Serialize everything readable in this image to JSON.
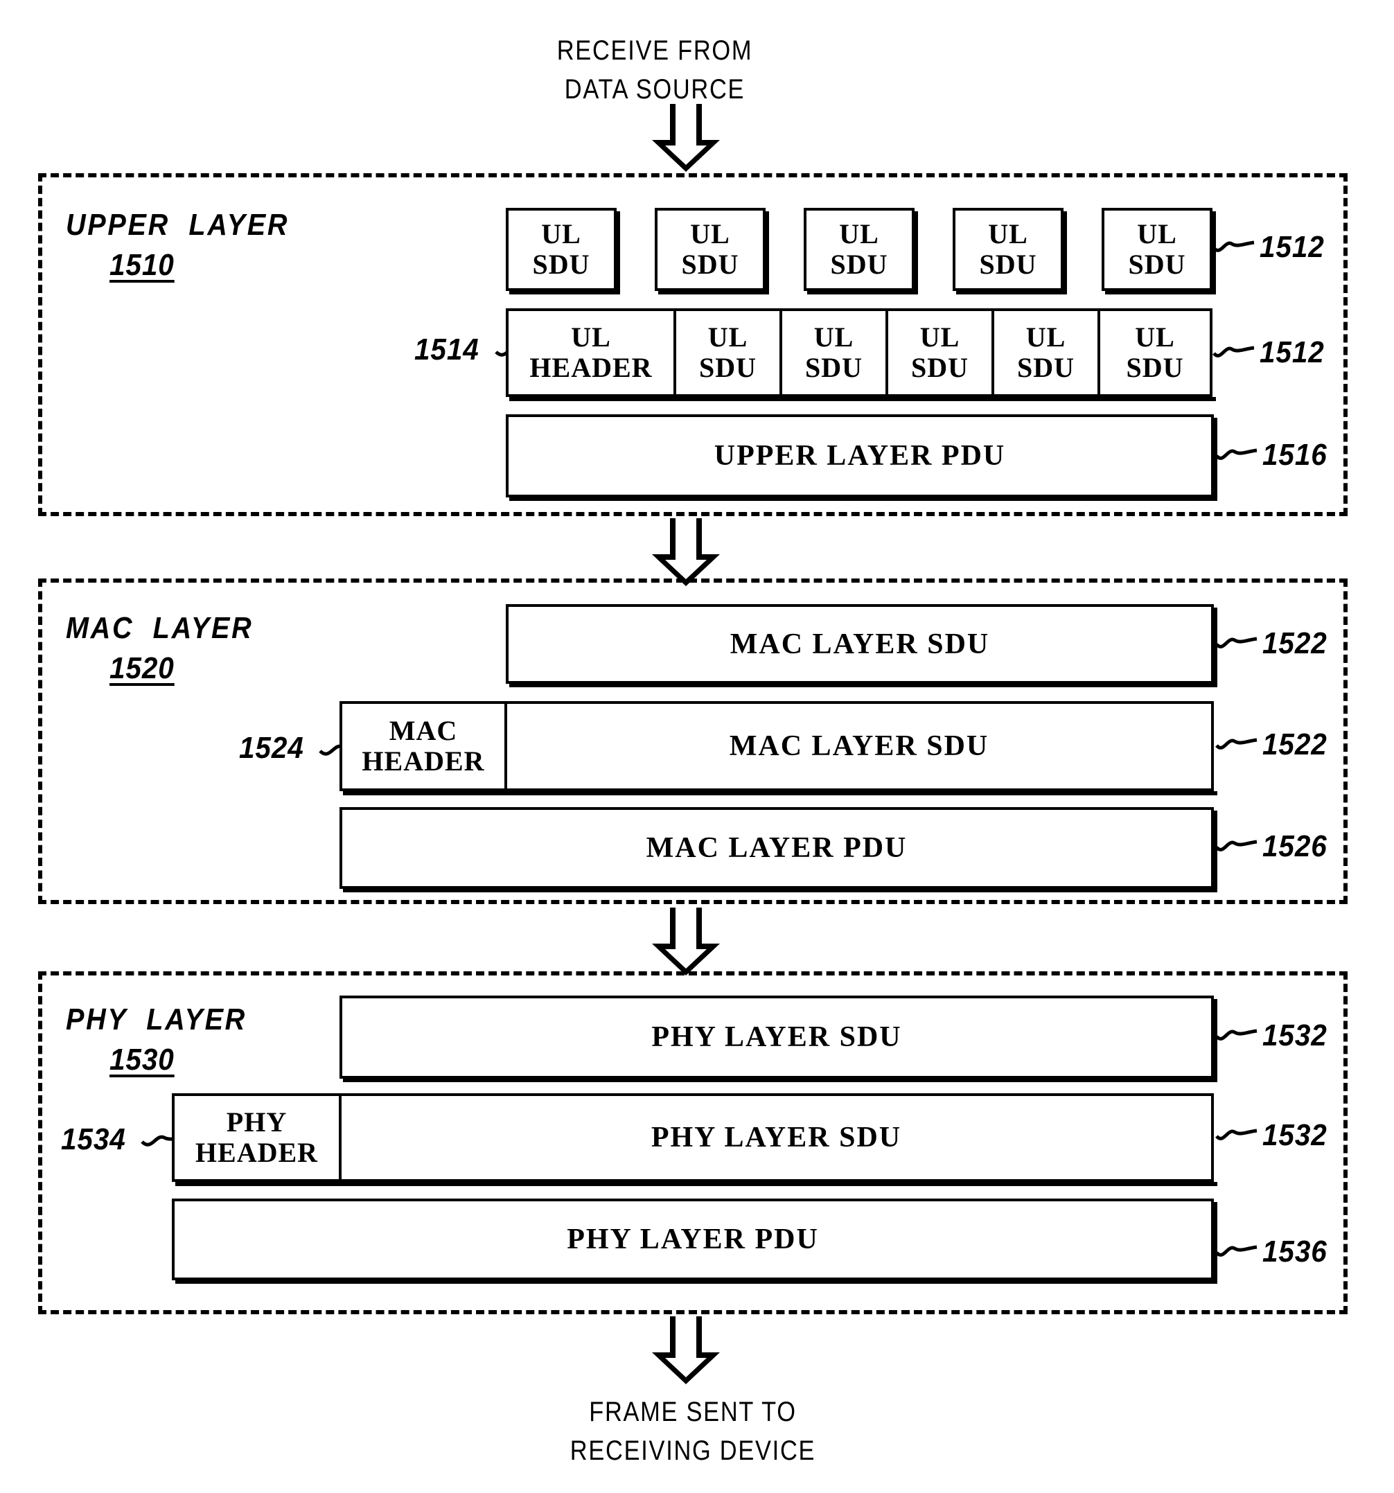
{
  "figure": {
    "top_caption": "RECEIVE FROM\nDATA SOURCE",
    "bottom_caption": "FRAME SENT TO\nRECEIVING DEVICE"
  },
  "layers": [
    {
      "id": "upper",
      "title": "UPPER  LAYER",
      "number": "1510",
      "rows": [
        {
          "kind": "sdu-row",
          "cells": [
            {
              "label": "UL\nSDU"
            },
            {
              "label": "UL\nSDU"
            },
            {
              "label": "UL\nSDU"
            },
            {
              "label": "UL\nSDU"
            },
            {
              "label": "UL\nSDU"
            }
          ],
          "right_ref": "1512",
          "left_ref": ""
        },
        {
          "kind": "pdu-row",
          "cells": [
            {
              "label": "UL\nHEADER"
            },
            {
              "label": "UL\nSDU"
            },
            {
              "label": "UL\nSDU"
            },
            {
              "label": "UL\nSDU"
            },
            {
              "label": "UL\nSDU"
            },
            {
              "label": "UL\nSDU"
            }
          ],
          "right_ref": "1512",
          "left_ref": "1514"
        },
        {
          "kind": "single",
          "cells": [
            {
              "label": "UPPER LAYER PDU"
            }
          ],
          "right_ref": "1516",
          "left_ref": ""
        }
      ]
    },
    {
      "id": "mac",
      "title": "MAC  LAYER",
      "number": "1520",
      "rows": [
        {
          "kind": "single",
          "cells": [
            {
              "label": "MAC LAYER SDU"
            }
          ],
          "right_ref": "1522",
          "left_ref": ""
        },
        {
          "kind": "header-sdu",
          "cells": [
            {
              "label": "MAC\nHEADER"
            },
            {
              "label": "MAC LAYER SDU"
            }
          ],
          "right_ref": "1522",
          "left_ref": "1524"
        },
        {
          "kind": "single",
          "cells": [
            {
              "label": "MAC LAYER PDU"
            }
          ],
          "right_ref": "1526",
          "left_ref": ""
        }
      ]
    },
    {
      "id": "phy",
      "title": "PHY  LAYER",
      "number": "1530",
      "rows": [
        {
          "kind": "single",
          "cells": [
            {
              "label": "PHY LAYER SDU"
            }
          ],
          "right_ref": "1532",
          "left_ref": ""
        },
        {
          "kind": "header-sdu",
          "cells": [
            {
              "label": "PHY\nHEADER"
            },
            {
              "label": "PHY LAYER SDU"
            }
          ],
          "right_ref": "1532",
          "left_ref": "1534"
        },
        {
          "kind": "single",
          "cells": [
            {
              "label": "PHY LAYER PDU"
            }
          ],
          "right_ref": "1536",
          "left_ref": ""
        }
      ]
    }
  ]
}
